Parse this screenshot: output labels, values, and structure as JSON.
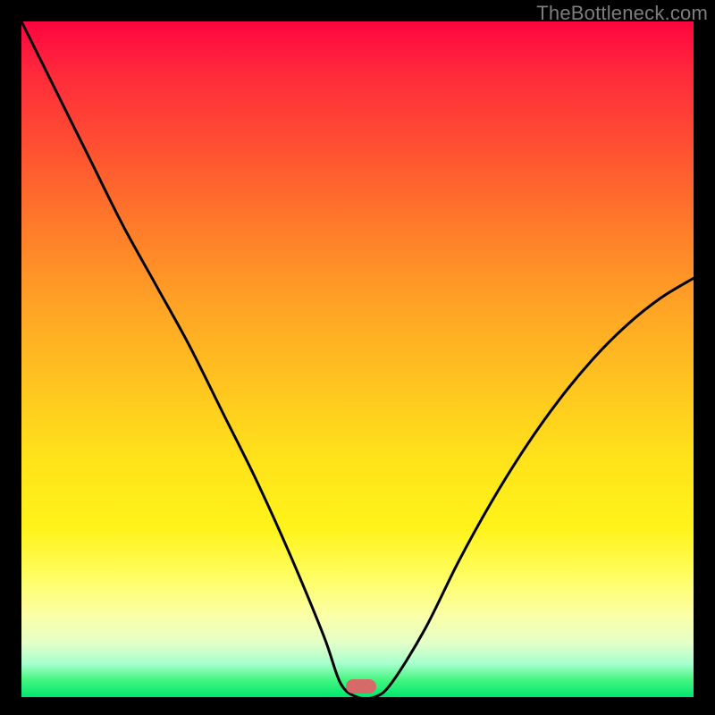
{
  "watermark": "TheBottleneck.com",
  "marker": {
    "x_frac": 0.505,
    "y_frac": 0.99
  },
  "chart_data": {
    "type": "line",
    "title": "",
    "xlabel": "",
    "ylabel": "",
    "xlim": [
      0,
      1
    ],
    "ylim": [
      0,
      1
    ],
    "series": [
      {
        "name": "bottleneck-curve",
        "x": [
          0.0,
          0.05,
          0.1,
          0.15,
          0.2,
          0.25,
          0.3,
          0.35,
          0.4,
          0.45,
          0.475,
          0.5,
          0.525,
          0.55,
          0.6,
          0.65,
          0.7,
          0.75,
          0.8,
          0.85,
          0.9,
          0.95,
          1.0
        ],
        "y": [
          1.0,
          0.9,
          0.8,
          0.7,
          0.61,
          0.52,
          0.42,
          0.32,
          0.21,
          0.09,
          0.02,
          0.0,
          0.0,
          0.02,
          0.1,
          0.2,
          0.29,
          0.37,
          0.44,
          0.5,
          0.55,
          0.59,
          0.62
        ]
      }
    ],
    "marker": {
      "x": 0.505,
      "y": 0.0
    },
    "gradient_note": "background encodes bottleneck severity: green (bottom)=good, red (top)=bad"
  }
}
